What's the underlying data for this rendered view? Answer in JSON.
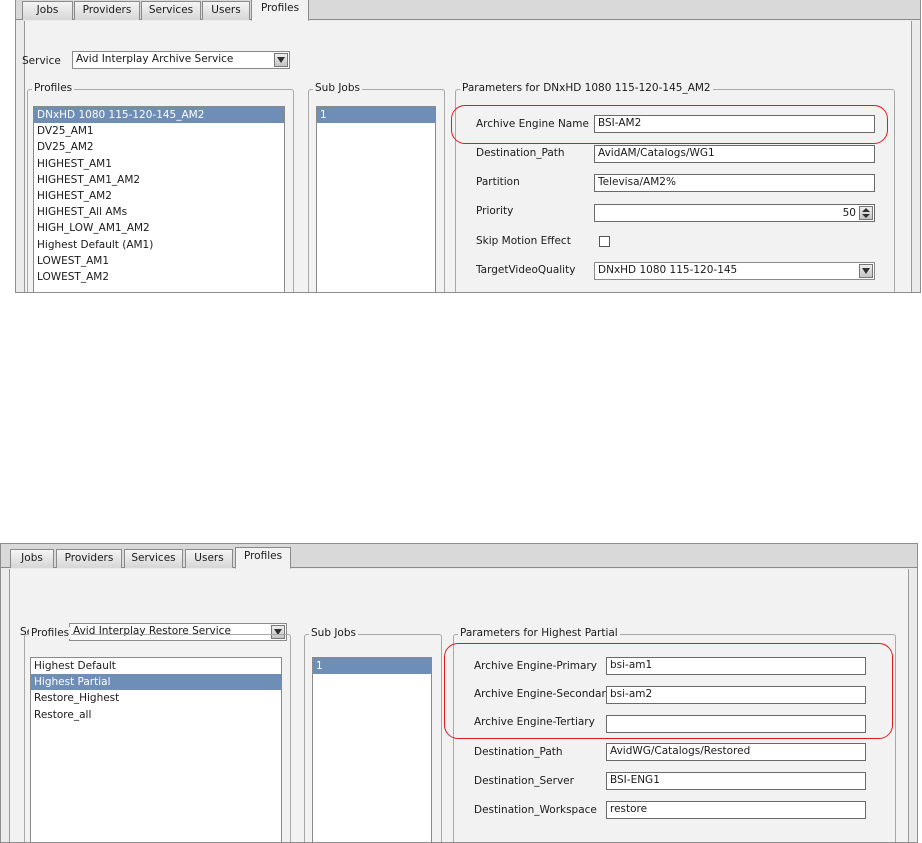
{
  "tabs": [
    "Jobs",
    "Providers",
    "Services",
    "Users",
    "Profiles"
  ],
  "active_tab": "Profiles",
  "colors": {
    "highlight": "#e01a1a",
    "selection": "#6f8eb7"
  },
  "top": {
    "service_label": "Service",
    "service_value": "Avid Interplay Archive Service",
    "profiles_title": "Profiles",
    "profiles": [
      "DNxHD 1080 115-120-145_AM2",
      "DV25_AM1",
      "DV25_AM2",
      "HIGHEST_AM1",
      "HIGHEST_AM1_AM2",
      "HIGHEST_AM2",
      "HIGHEST_All AMs",
      "HIGH_LOW_AM1_AM2",
      "Highest Default (AM1)",
      "LOWEST_AM1",
      "LOWEST_AM2"
    ],
    "selected_profile": "DNxHD 1080 115-120-145_AM2",
    "subjobs_title": "Sub Jobs",
    "subjobs": [
      "1"
    ],
    "params_title": "Parameters for DNxHD 1080 115-120-145_AM2",
    "params": {
      "archive_engine_name": {
        "label": "Archive Engine Name",
        "value": "BSI-AM2"
      },
      "destination_path": {
        "label": "Destination_Path",
        "value": "AvidAM/Catalogs/WG1"
      },
      "partition": {
        "label": "Partition",
        "value": "Televisa/AM2%"
      },
      "priority": {
        "label": "Priority",
        "value": "50"
      },
      "skip_motion_effect": {
        "label": "Skip Motion Effect",
        "checked": false
      },
      "target_video_quality": {
        "label": "TargetVideoQuality",
        "value": "DNxHD 1080 115-120-145"
      }
    }
  },
  "bottom": {
    "service_label": "Service",
    "service_value": "Avid Interplay Restore Service",
    "profiles_title": "Profiles",
    "profiles": [
      "Highest Default",
      "Highest Partial",
      "Restore_Highest",
      "Restore_all"
    ],
    "selected_profile": "Highest Partial",
    "subjobs_title": "Sub Jobs",
    "subjobs": [
      "1"
    ],
    "params_title": "Parameters for Highest Partial",
    "params": {
      "engine_primary": {
        "label": "Archive Engine-Primary",
        "value": "bsi-am1"
      },
      "engine_secondary": {
        "label": "Archive Engine-Secondary",
        "value": "bsi-am2"
      },
      "engine_tertiary": {
        "label": "Archive Engine-Tertiary",
        "value": ""
      },
      "destination_path": {
        "label": "Destination_Path",
        "value": "AvidWG/Catalogs/Restored"
      },
      "destination_server": {
        "label": "Destination_Server",
        "value": "BSI-ENG1"
      },
      "destination_workspace": {
        "label": "Destination_Workspace",
        "value": "restore"
      }
    }
  }
}
